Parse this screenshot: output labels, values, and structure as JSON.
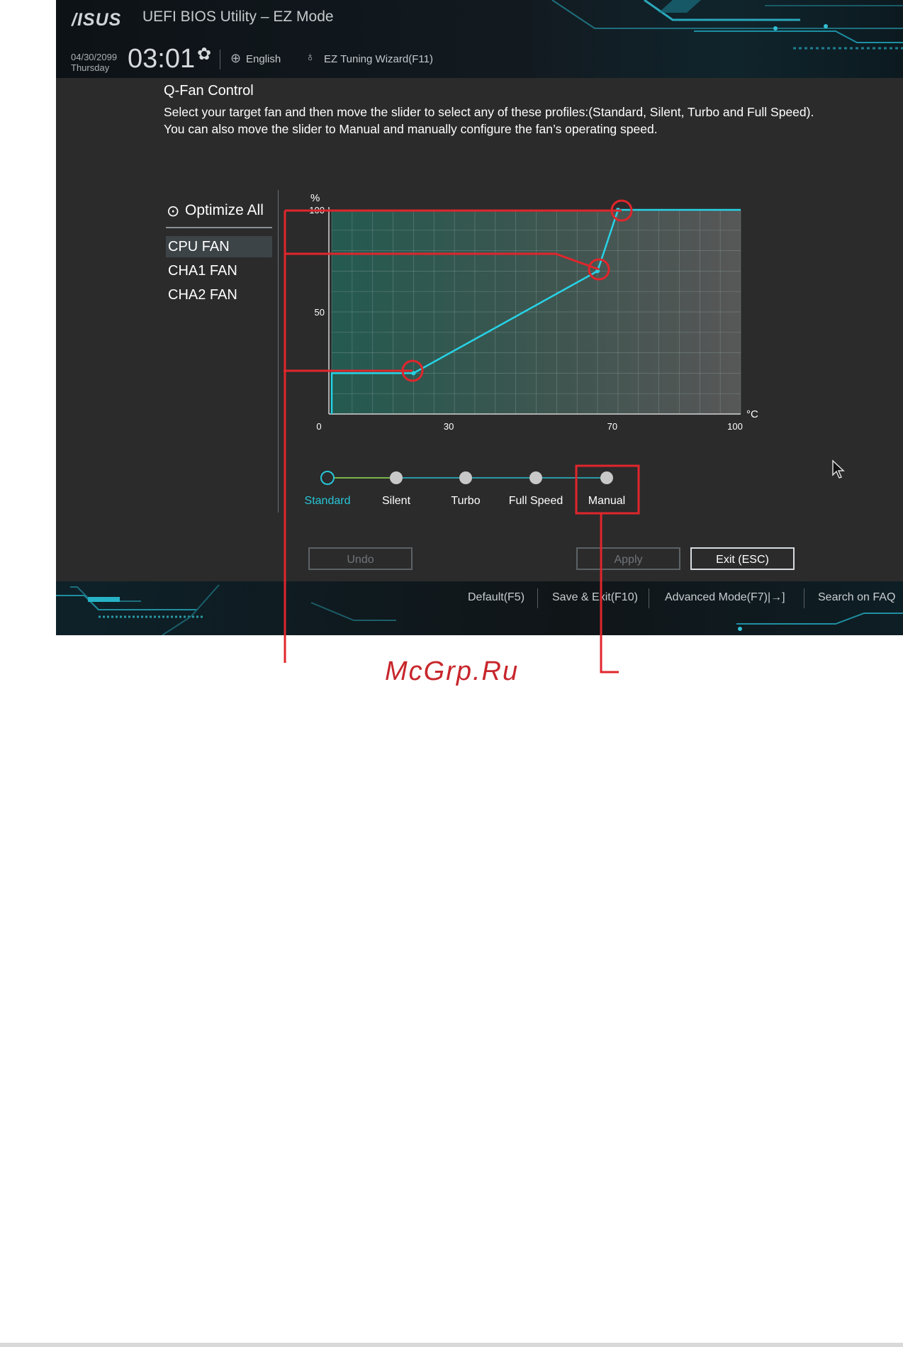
{
  "header": {
    "logo": "/ISUS",
    "app_title": "UEFI BIOS Utility – EZ Mode",
    "date": "04/30/2099",
    "weekday": "Thursday",
    "time": "03:01",
    "settings_icon": "gear-icon",
    "language": "English",
    "language_icon": "globe-icon",
    "wizard": "EZ Tuning Wizard(F11)",
    "wizard_icon": "lightbulb-icon"
  },
  "qfan": {
    "title": "Q-Fan Control",
    "description": "Select your target fan and then move the slider to select any of these profiles:(Standard, Silent, Turbo and Full Speed). You can also move the slider to Manual and manually configure the fan’s operating speed.",
    "optimize_all": "Optimize All",
    "optimize_icon": "gauge-icon",
    "fans": [
      "CPU FAN",
      "CHA1 FAN",
      "CHA2 FAN"
    ],
    "selected_fan": "CPU FAN"
  },
  "chart_data": {
    "type": "line",
    "title": "",
    "xlabel": "°C",
    "ylabel": "%",
    "x_ticks": [
      "0",
      "30",
      "70",
      "100"
    ],
    "y_ticks": [
      "50",
      "100"
    ],
    "xlim": [
      0,
      100
    ],
    "ylim": [
      0,
      100
    ],
    "grid": true,
    "series": [
      {
        "points": [
          [
            0,
            0
          ],
          [
            0,
            20
          ],
          [
            20,
            20
          ],
          [
            65,
            70
          ],
          [
            70,
            100
          ],
          [
            100,
            100
          ]
        ],
        "color": "#27d3e6"
      }
    ],
    "highlighted_points": [
      [
        20,
        20
      ],
      [
        65,
        70
      ],
      [
        70,
        100
      ]
    ]
  },
  "profiles": {
    "items": [
      "Standard",
      "Silent",
      "Turbo",
      "Full Speed",
      "Manual"
    ],
    "active": "Standard",
    "highlighted": "Manual"
  },
  "buttons": {
    "undo": "Undo",
    "apply": "Apply",
    "exit": "Exit (ESC)"
  },
  "bottom_bar": {
    "default": "Default(F5)",
    "save_exit": "Save & Exit(F10)",
    "advanced": "Advanced Mode(F7)|→]",
    "faq": "Search on FAQ"
  },
  "watermark": "McGrp.Ru",
  "colors": {
    "accent": "#27d3e6",
    "annotation": "#e0262c",
    "chart_fill_left": "#245a50",
    "chart_fill_right": "#555555"
  }
}
